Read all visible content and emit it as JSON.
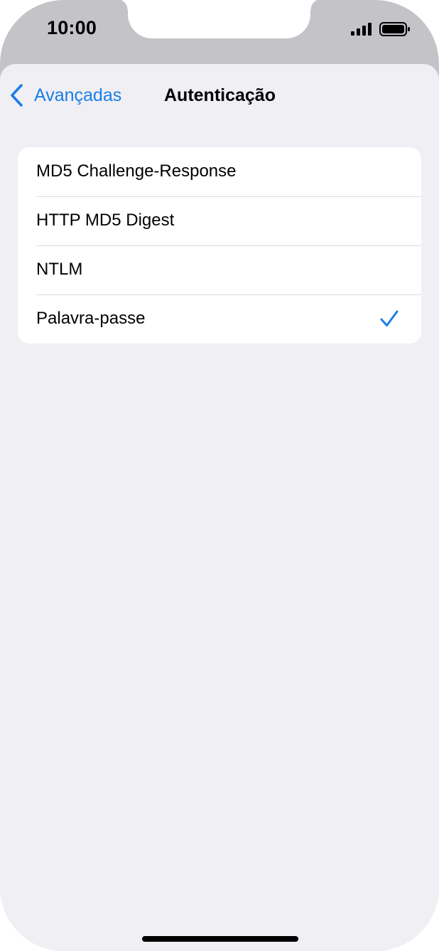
{
  "status_bar": {
    "time": "10:00"
  },
  "nav": {
    "back_label": "Avançadas",
    "title": "Autenticação"
  },
  "options": [
    {
      "label": "MD5 Challenge-Response",
      "selected": false
    },
    {
      "label": "HTTP MD5 Digest",
      "selected": false
    },
    {
      "label": "NTLM",
      "selected": false
    },
    {
      "label": "Palavra-passe",
      "selected": true
    }
  ],
  "colors": {
    "accent": "#1a7ee6",
    "background": "#f0eff4",
    "frame": "#c4c4c8"
  },
  "icons": {
    "back": "chevron-left-icon",
    "check": "checkmark-icon",
    "signal": "cellular-signal-icon",
    "battery": "battery-icon"
  }
}
